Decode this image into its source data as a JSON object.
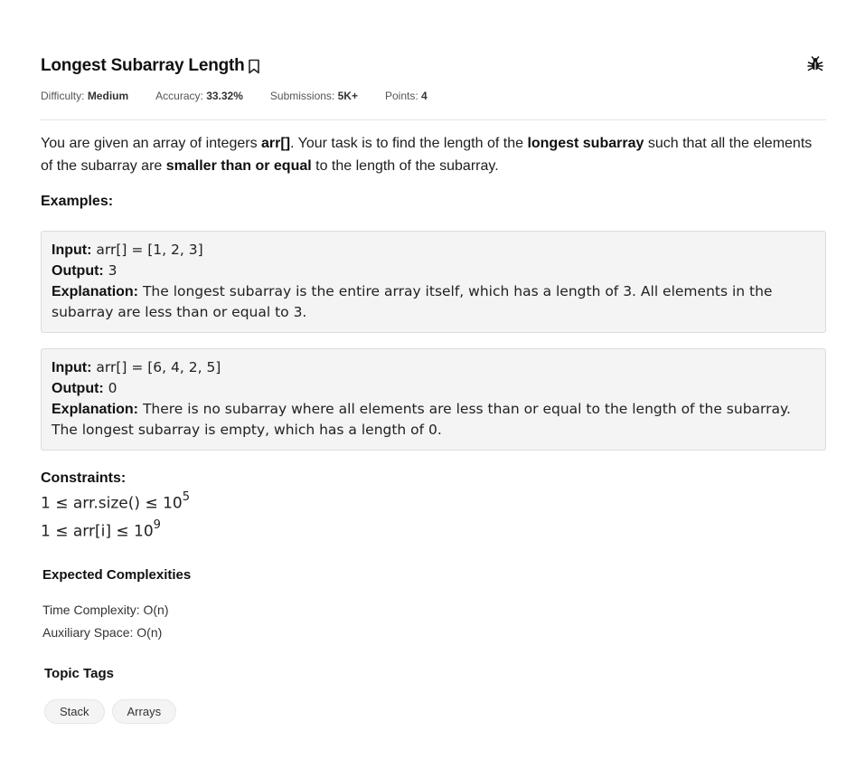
{
  "problem": {
    "title": "Longest Subarray Length",
    "meta": {
      "difficulty_label": "Difficulty:",
      "difficulty_value": "Medium",
      "accuracy_label": "Accuracy:",
      "accuracy_value": "33.32%",
      "submissions_label": "Submissions:",
      "submissions_value": "5K+",
      "points_label": "Points:",
      "points_value": "4"
    },
    "description": {
      "p1": "You are given an array of integers ",
      "b1": "arr[]",
      "p2": ". Your task is to find the length of the ",
      "b2": "longest subarray",
      "p3": " such that all the elements of the subarray are ",
      "b3": "smaller than or equal",
      "p4": " to the length of the subarray."
    },
    "examples_heading": "Examples:",
    "examples": [
      {
        "input_label": "Input:",
        "input_value": " arr[] = [1, 2, 3]",
        "output_label": "Output:",
        "output_value": " 3",
        "explanation_label": "Explanation:",
        "explanation_value": " The longest subarray is the entire array itself, which has a length of 3. All elements in the subarray are less than or equal to 3."
      },
      {
        "input_label": "Input:",
        "input_value": " arr[] = [6, 4, 2, 5]",
        "output_label": "Output:",
        "output_value": " 0",
        "explanation_label": "Explanation:",
        "explanation_value": " There is no subarray where all elements are less than or equal to the length of the subarray. The longest subarray is empty, which has a length of 0."
      }
    ],
    "constraints_heading": "Constraints:",
    "constraints": [
      {
        "text": "1 ≤ arr.size() ≤ 10",
        "exp": "5"
      },
      {
        "text": "1 ≤ arr[i] ≤ 10",
        "exp": "9"
      }
    ],
    "complexities_heading": "Expected Complexities",
    "time_complexity": "Time Complexity: O(n)",
    "aux_space": "Auxiliary Space: O(n)",
    "tags_heading": "Topic Tags",
    "tags": [
      "Stack",
      "Arrays"
    ]
  },
  "icons": {
    "bookmark": "bookmark-icon",
    "report": "bug-icon"
  }
}
